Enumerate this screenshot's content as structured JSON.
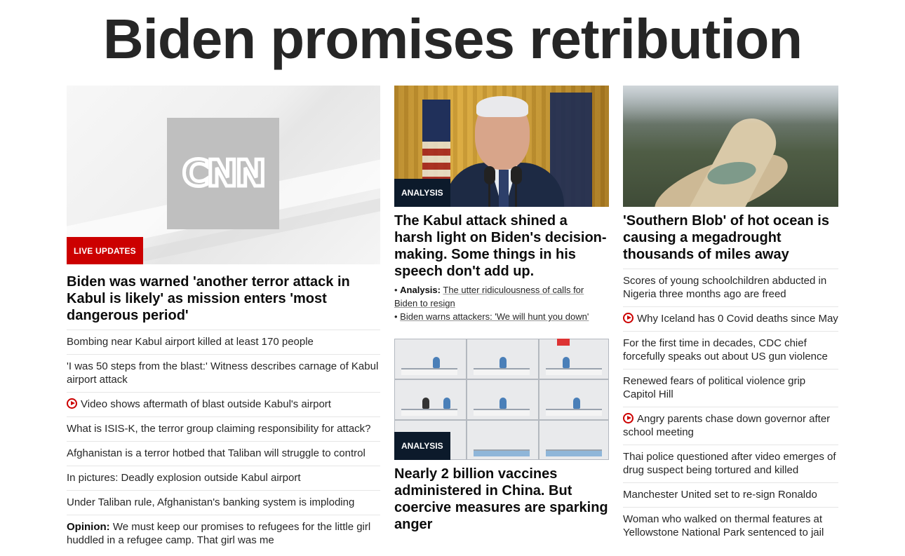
{
  "page_headline": "Biden promises retribution",
  "colors": {
    "live_red": "#cc0000",
    "analysis_navy": "#0c1a2b"
  },
  "col1": {
    "hero_logo_text": "CNN",
    "badge": "LIVE UPDATES",
    "title": "Biden was warned 'another terror attack in Kabul is likely' as mission enters 'most dangerous period'",
    "items": [
      {
        "video": false,
        "prefix": "",
        "text": "Bombing near Kabul airport killed at least 170 people"
      },
      {
        "video": false,
        "prefix": "",
        "text": "'I was 50 steps from the blast:' Witness describes carnage of Kabul airport attack"
      },
      {
        "video": true,
        "prefix": "",
        "text": "Video shows aftermath of blast outside Kabul's airport"
      },
      {
        "video": false,
        "prefix": "",
        "text": "What is ISIS-K, the terror group claiming responsibility for attack?"
      },
      {
        "video": false,
        "prefix": "",
        "text": "Afghanistan is a terror hotbed that Taliban will struggle to control"
      },
      {
        "video": false,
        "prefix": "",
        "text": "In pictures: Deadly explosion outside Kabul airport"
      },
      {
        "video": false,
        "prefix": "",
        "text": "Under Taliban rule, Afghanistan's banking system is imploding"
      },
      {
        "video": false,
        "prefix": "Opinion:",
        "text": "We must keep our promises to refugees for the little girl huddled in a refugee camp. That girl was me"
      }
    ]
  },
  "col2": {
    "story1": {
      "badge": "ANALYSIS",
      "title": "The Kabul attack shined a harsh light on Biden's decision-making. Some things in his speech don't add up.",
      "link1_prefix": "Analysis:",
      "link1_text": "The utter ridiculousness of calls for Biden to resign",
      "link2_text": "Biden warns attackers: 'We will hunt you down'"
    },
    "story2": {
      "badge": "ANALYSIS",
      "title": "Nearly 2 billion vaccines administered in China. But coercive measures are sparking anger"
    }
  },
  "col3": {
    "title": "'Southern Blob' of hot ocean is causing a megadrought thousands of miles away",
    "items": [
      {
        "video": false,
        "text": "Scores of young schoolchildren abducted in Nigeria three months ago are freed"
      },
      {
        "video": true,
        "text": "Why Iceland has 0 Covid deaths since May"
      },
      {
        "video": false,
        "text": "For the first time in decades, CDC chief forcefully speaks out about US gun violence"
      },
      {
        "video": false,
        "text": "Renewed fears of political violence grip Capitol Hill"
      },
      {
        "video": true,
        "text": "Angry parents chase down governor after school meeting"
      },
      {
        "video": false,
        "text": "Thai police questioned after video emerges of drug suspect being tortured and killed"
      },
      {
        "video": false,
        "text": "Manchester United set to re-sign Ronaldo"
      },
      {
        "video": false,
        "text": "Woman who walked on thermal features at Yellowstone National Park sentenced to jail"
      }
    ]
  }
}
